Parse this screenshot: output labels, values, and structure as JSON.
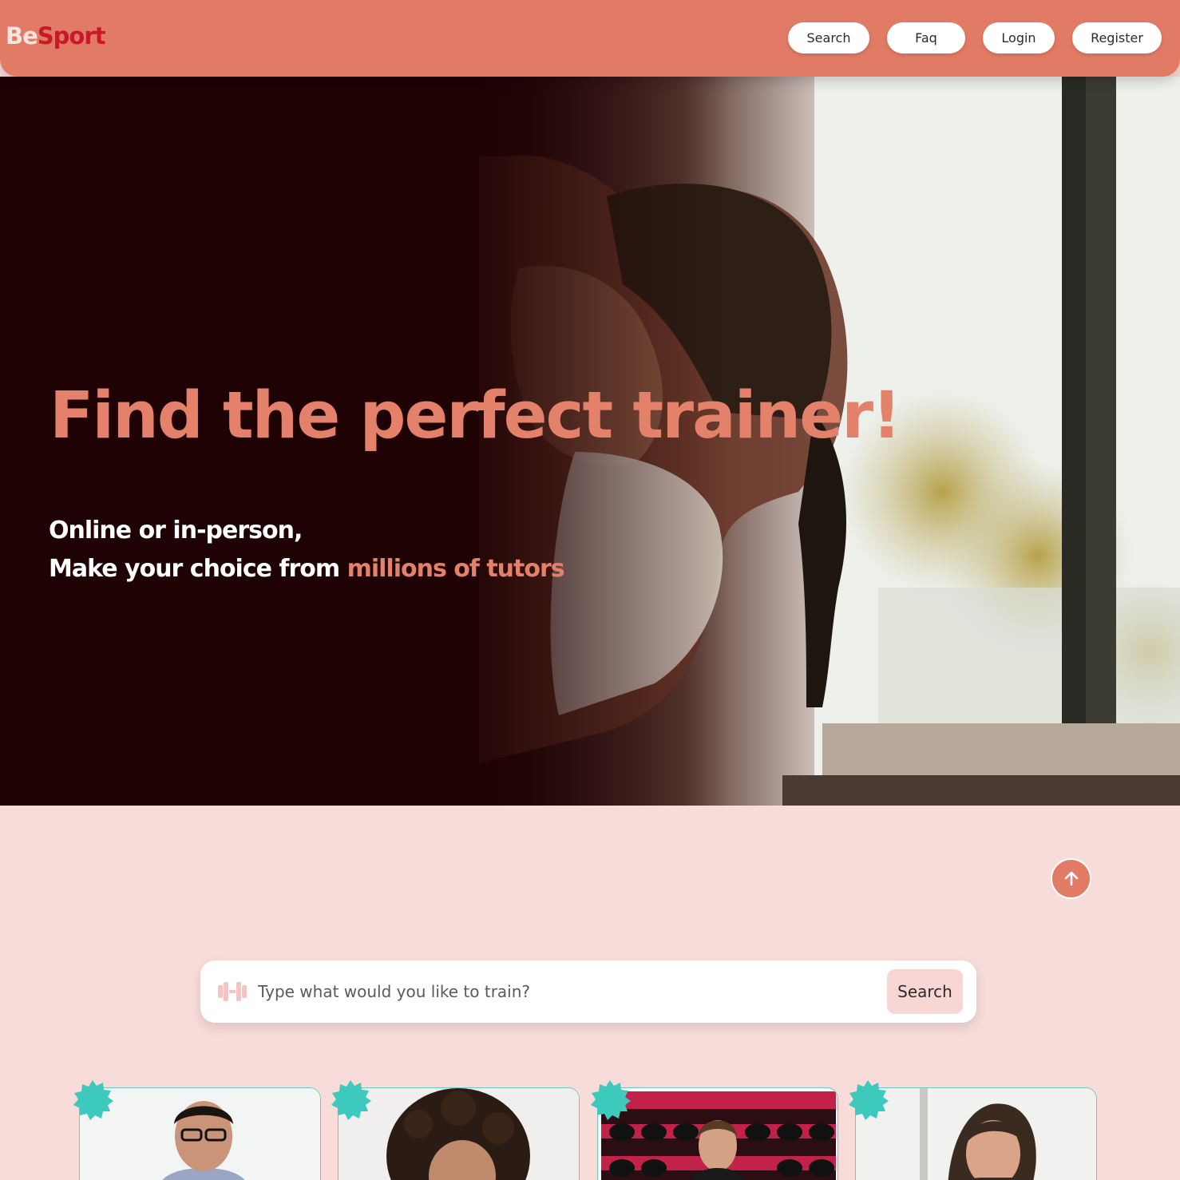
{
  "header": {
    "logo_be": "Be",
    "logo_sport": "Sport",
    "nav": [
      {
        "label": "Search"
      },
      {
        "label": "Faq"
      },
      {
        "label": "Login"
      },
      {
        "label": "Register"
      }
    ]
  },
  "hero": {
    "title": "Find the perfect trainer!",
    "subtitle_line1": "Online or in-person,",
    "subtitle_line2_prefix": "Make your choice from ",
    "subtitle_line2_accent": "millions of tutors"
  },
  "search": {
    "placeholder": "Type what would you like to train?",
    "button_label": "Search",
    "icon": "dumbbell-icon"
  },
  "scroll_top": {
    "icon": "arrow-up-icon"
  },
  "cards": [
    {
      "name": "trainer-card-1",
      "badge": "star-badge-icon"
    },
    {
      "name": "trainer-card-2",
      "badge": "star-badge-icon"
    },
    {
      "name": "trainer-card-3",
      "badge": "star-badge-icon"
    },
    {
      "name": "trainer-card-4",
      "badge": "star-badge-icon"
    }
  ],
  "colors": {
    "brand": "#e17b66",
    "logo_red": "#c8182a",
    "page_bg": "#f8dcd9",
    "hero_dark": "#1e0204",
    "accent_teal": "#3ec9bd"
  }
}
